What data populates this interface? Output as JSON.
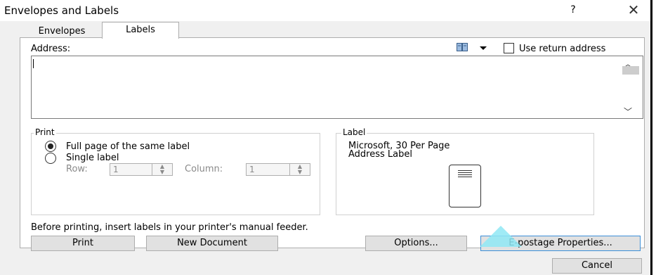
{
  "window": {
    "title": "Envelopes and Labels",
    "help_glyph": "?",
    "close_glyph": "✕"
  },
  "tabs": [
    {
      "label": "Envelopes",
      "active": false
    },
    {
      "label": "Labels",
      "active": true
    }
  ],
  "address": {
    "label": "Address:",
    "value": "",
    "address_book_icon": "address-book-icon",
    "return_address_label": "Use return address",
    "return_address_checked": false
  },
  "print_group": {
    "legend": "Print",
    "options": [
      {
        "label": "Full page of the same label",
        "selected": true
      },
      {
        "label": "Single label",
        "selected": false
      }
    ],
    "row_label": "Row:",
    "row_value": "1",
    "column_label": "Column:",
    "column_value": "1"
  },
  "label_group": {
    "legend": "Label",
    "line1": "Microsoft, 30 Per Page",
    "line2": "Address Label"
  },
  "hint": "Before printing, insert labels in your printer's manual feeder.",
  "buttons": {
    "print": "Print",
    "new_document": "New Document",
    "options": "Options...",
    "epostage": "E-postage Properties...",
    "cancel": "Cancel"
  },
  "colors": {
    "dialog_bg": "#f0f0f0",
    "focus_border": "#3c8fd8",
    "cursor_highlight": "#8fe8f4"
  }
}
